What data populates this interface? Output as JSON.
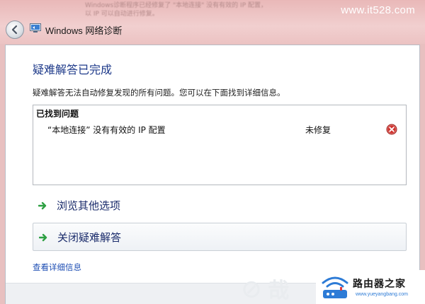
{
  "background": {
    "blurred_line1": "Windows诊断程序已经修复了 \"本地连接\" 没有有效的 IP 配置，",
    "blurred_line2": "以 IP 可以自动进行修复。"
  },
  "watermark": "www.it528.com",
  "window": {
    "title": "Windows 网络诊断",
    "icon": "network-diagnostics-icon"
  },
  "main": {
    "heading": "疑难解答已完成",
    "description": "疑难解答无法自动修复发现的所有问题。您可以在下面找到详细信息。",
    "problems": {
      "header": "已找到问题",
      "items": [
        {
          "name": "“本地连接” 没有有效的 IP 配置",
          "status": "未修复",
          "icon": "error-x-icon"
        }
      ]
    },
    "options": [
      {
        "label": "浏览其他选项",
        "icon": "green-arrow-icon"
      },
      {
        "label": "关闭疑难解答",
        "icon": "green-arrow-icon"
      }
    ],
    "details_link": "查看详细信息"
  },
  "logo": {
    "name": "路由器之家",
    "url": "www.yueyangbang.com"
  },
  "colors": {
    "heading": "#1e3a8a",
    "link": "#1f4fb4",
    "error": "#d0332e",
    "arrow": "#2ea043"
  }
}
